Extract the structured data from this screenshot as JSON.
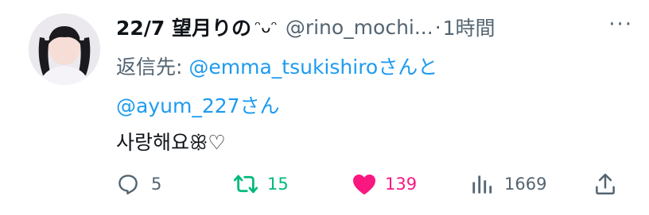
{
  "tweet": {
    "display_name": "22/7 望月りの",
    "name_emoji": "ᵔᴗᵔ",
    "handle": "@rino_mochi...",
    "separator": "·",
    "time": "1時間",
    "more": "···",
    "reply_prefix": "返信先: ",
    "reply_mention_1": "@emma_tsukishiro",
    "reply_and": "さんと",
    "reply_mention_2": "@ayum_227",
    "reply_suffix": "さん",
    "text": "사랑해요ꕥ♡",
    "actions": {
      "replies": "5",
      "retweets": "15",
      "likes": "139",
      "views": "1669"
    }
  },
  "colors": {
    "muted": "#536471",
    "link": "#1d9bf0",
    "retweet": "#00ba7c",
    "like": "#f91880"
  }
}
